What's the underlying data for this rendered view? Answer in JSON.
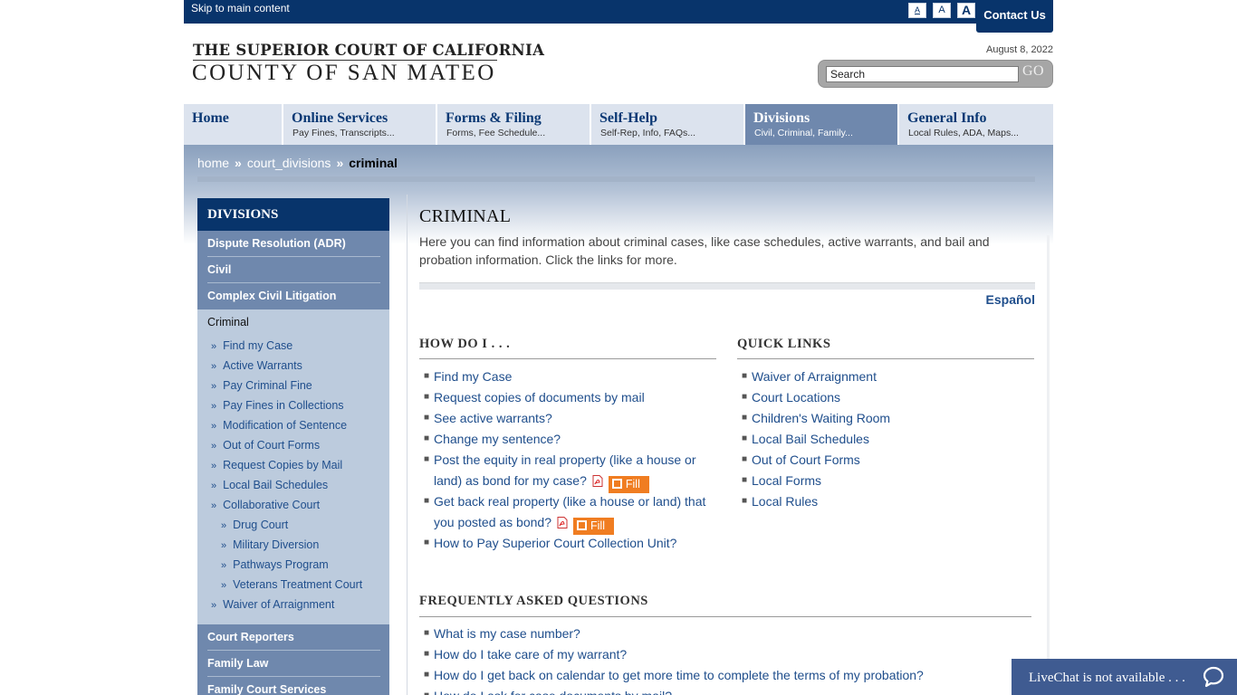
{
  "topbar": {
    "skip_link": "Skip to main content",
    "font_small": "A",
    "font_medium": "A",
    "font_large": "A",
    "contact": "Contact Us"
  },
  "header": {
    "logo_line1": "THE SUPERIOR COURT OF CALIFORNIA",
    "logo_line2": "COUNTY OF SAN MATEO",
    "date": "August 8, 2022",
    "search_value": "Search",
    "go_label": "GO"
  },
  "nav": [
    {
      "title": "Home",
      "sub": ""
    },
    {
      "title": "Online Services",
      "sub": "Pay Fines, Transcripts..."
    },
    {
      "title": "Forms & Filing",
      "sub": "Forms, Fee Schedule..."
    },
    {
      "title": "Self-Help",
      "sub": "Self-Rep, Info, FAQs..."
    },
    {
      "title": "Divisions",
      "sub": "Civil, Criminal, Family..."
    },
    {
      "title": "General Info",
      "sub": "Local Rules, ADA, Maps..."
    }
  ],
  "breadcrumb": {
    "home": "home",
    "sep1": "»",
    "divisions": "court_divisions",
    "sep2": "»",
    "current": "criminal"
  },
  "sidebar": {
    "heading": "DIVISIONS",
    "top_items": [
      "Dispute Resolution (ADR)",
      "Civil",
      "Complex Civil Litigation"
    ],
    "current": "Criminal",
    "sub_items": [
      "Find my Case",
      "Active Warrants",
      "Pay Criminal Fine",
      "Pay Fines in Collections",
      "Modification of Sentence",
      "Out of Court Forms",
      "Request Copies by Mail",
      "Local Bail Schedules",
      "Collaborative Court"
    ],
    "sub_sub_items": [
      "Drug Court",
      "Military Diversion",
      "Pathways Program",
      "Veterans Treatment Court"
    ],
    "last_sub": "Waiver of Arraignment",
    "bottom_items": [
      "Court Reporters",
      "Family Law",
      "Family Court Services"
    ],
    "chevron": "»"
  },
  "main": {
    "title": "CRIMINAL",
    "intro": "Here you can find information about criminal cases, like case schedules, active warrants, and bail and probation information. Click the links for more.",
    "espanol": "Español",
    "howdoi": {
      "heading": "HOW DO I . . .",
      "links": [
        "Find my Case",
        "Request copies of documents by mail",
        "See active warrants?",
        "Change my sentence?"
      ],
      "equity_line1": "Post the equity in real property (like a house or",
      "equity_line2": "land) as bond for my case?",
      "getback_line1": "Get back real property (like a house or land) that",
      "getback_line2": "you posted as bond?",
      "collection": "How to Pay Superior Court Collection Unit?",
      "fill_label": "Fill"
    },
    "quicklinks": {
      "heading": "QUICK LINKS",
      "links": [
        "Waiver of Arraignment",
        "Court Locations",
        "Children's Waiting Room",
        "Local Bail Schedules",
        "Out of Court Forms",
        "Local Forms",
        "Local Rules"
      ]
    },
    "faq": {
      "heading": "FREQUENTLY ASKED QUESTIONS",
      "links": [
        "What is my case number?",
        "How do I take care of my warrant?",
        "How do I get back on calendar to get more time to complete the terms of my probation?",
        "How do I ask for case documents by mail?"
      ]
    }
  },
  "livechat": {
    "label": "LiveChat is not available . . ."
  },
  "colors": {
    "navy": "#08346b",
    "link": "#1f4e8c",
    "fill_orange": "#f07d21",
    "side_item": "#6f88ad",
    "side_bg": "#bccbdd"
  }
}
